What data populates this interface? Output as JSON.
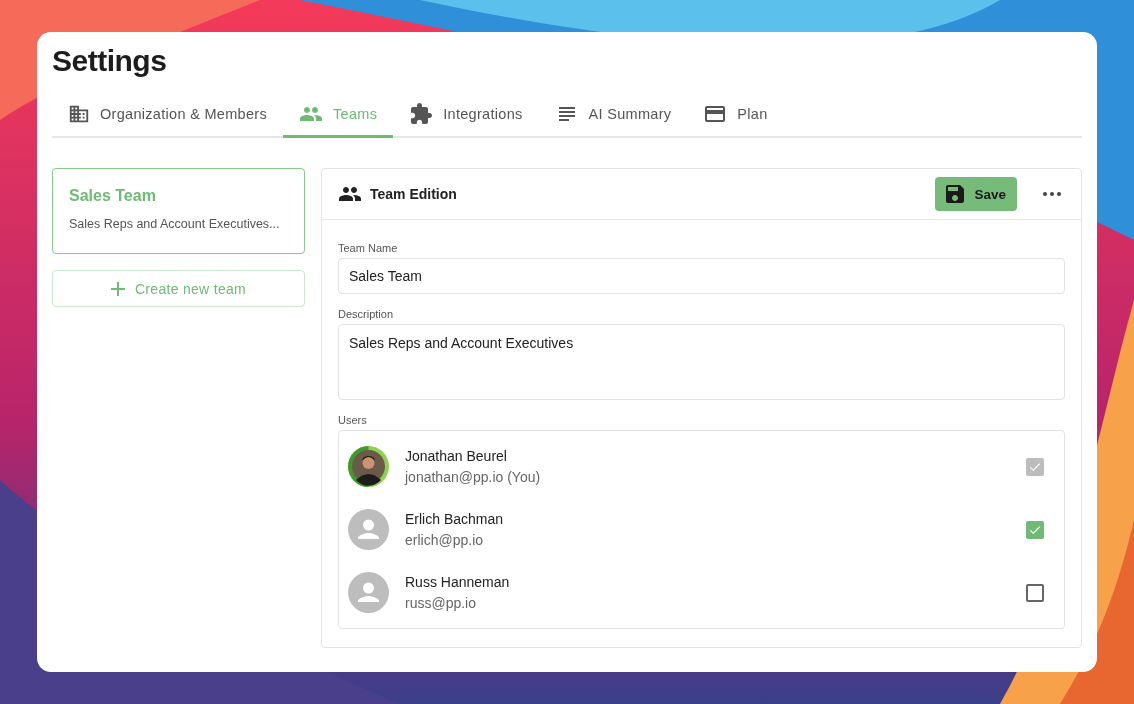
{
  "title": "Settings",
  "tabs": [
    {
      "label": "Organization & Members",
      "selected": false
    },
    {
      "label": "Teams",
      "selected": true
    },
    {
      "label": "Integrations",
      "selected": false
    },
    {
      "label": "AI Summary",
      "selected": false
    },
    {
      "label": "Plan",
      "selected": false
    }
  ],
  "teams": [
    {
      "name": "Sales Team",
      "description": "Sales Reps and Account Executives...",
      "selected": true
    }
  ],
  "create_button": {
    "label": "Create new team"
  },
  "editor": {
    "title": "Team Edition",
    "save_label": "Save",
    "fields": [
      {
        "label": "Team Name",
        "value": "Sales Team",
        "kind": "input"
      },
      {
        "label": "Description",
        "value": "Sales Reps and Account Executives",
        "kind": "textarea"
      }
    ],
    "users_label": "Users",
    "users": [
      {
        "name": "Jonathan Beurel",
        "email": "jonathan@pp.io (You)",
        "checked": true,
        "disabled": true
      },
      {
        "name": "Erlich Bachman",
        "email": "erlich@pp.io",
        "kind": "placeholder",
        "checked": true,
        "disabled": false
      },
      {
        "name": "Russ Hanneman",
        "email": "russ@pp.io",
        "kind": "placeholder",
        "checked": false,
        "disabled": false
      }
    ]
  }
}
